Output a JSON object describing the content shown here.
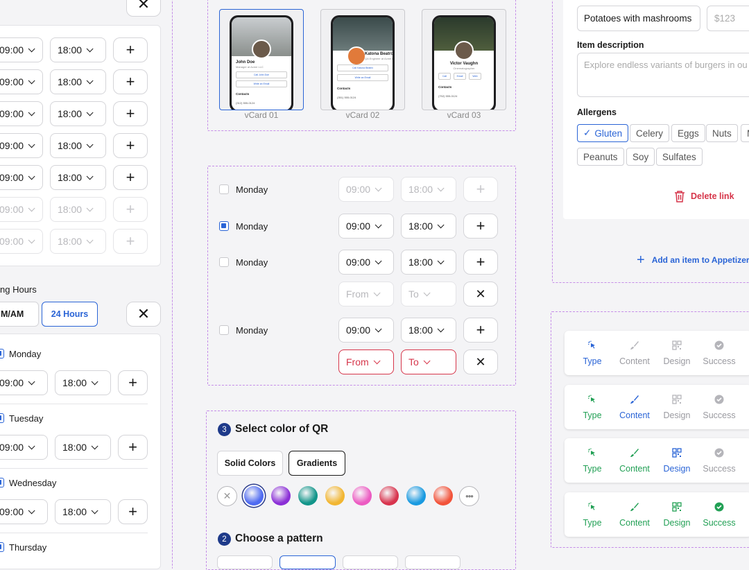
{
  "left": {
    "hours": [
      {
        "from": "09:00",
        "to": "18:00",
        "disabled": false
      },
      {
        "from": "09:00",
        "to": "18:00",
        "disabled": false
      },
      {
        "from": "09:00",
        "to": "18:00",
        "disabled": false
      },
      {
        "from": "09:00",
        "to": "18:00",
        "disabled": false
      },
      {
        "from": "09:00",
        "to": "18:00",
        "disabled": false
      },
      {
        "from": "09:00",
        "to": "18:00",
        "disabled": true
      },
      {
        "from": "09:00",
        "to": "18:00",
        "disabled": true
      }
    ],
    "section_label": "ng Hours",
    "fmt_am": "M/AM",
    "fmt_24": "24 Hours",
    "days": [
      {
        "day": "Monday",
        "from": "09:00",
        "to": "18:00"
      },
      {
        "day": "Tuesday",
        "from": "09:00",
        "to": "18:00"
      },
      {
        "day": "Wednesday",
        "from": "09:00",
        "to": "18:00"
      },
      {
        "day": "Thursday"
      }
    ]
  },
  "vcards": [
    {
      "label": "vCard 01",
      "name": "John Doe",
      "role": "Manager at Acme LLC",
      "btn1": "Call John Doe",
      "btn2": "Write an Email",
      "contacts": "Contacts",
      "phone": "(312) 555-0124"
    },
    {
      "label": "vCard 02",
      "name": "Katona Beatrix",
      "role": "QA Engineer at Acme LLC",
      "btn1": "Call Katona Beatrix",
      "btn2": "Write an Email",
      "contacts": "Contacts",
      "phone": "(351) 555-0124"
    },
    {
      "label": "vCard 03",
      "name": "Victor Vaughn",
      "role": "Cinematographer",
      "btn1": "Call",
      "btn2": "Email",
      "btn3": "Web",
      "contacts": "Contacts",
      "phone": "(752) 555-0124"
    }
  ],
  "schedule": {
    "rows": [
      {
        "day": "Monday",
        "from": "09:00",
        "to": "18:00"
      },
      {
        "day": "Monday",
        "from": "09:00",
        "to": "18:00"
      },
      {
        "day": "Monday",
        "from": "09:00",
        "to": "18:00",
        "extra_from": "From",
        "extra_to": "To"
      },
      {
        "day": "Monday",
        "from": "09:00",
        "to": "18:00",
        "extra_from": "From",
        "extra_to": "To"
      }
    ]
  },
  "qr": {
    "step3_num": "3",
    "step3_title": "Select color of QR",
    "tab_solid": "Solid Colors",
    "tab_grad": "Gradients",
    "colors": [
      "#4f6bf2",
      "#8b2fd6",
      "#12958a",
      "#f2b632",
      "#ec5bc2",
      "#d8344e",
      "#1a9ae0",
      "#f2533a"
    ],
    "step2_num": "2",
    "step2_title": "Choose a pattern"
  },
  "item": {
    "name": "Potatoes with mashrooms",
    "price_placeholder": "$123",
    "desc_label": "Item description",
    "desc_placeholder": "Explore endless variants of burgers in ou",
    "allergens_label": "Allergens",
    "allergens": [
      "Gluten",
      "Celery",
      "Eggs",
      "Nuts",
      "M",
      "Peanuts",
      "Soy",
      "Sulfates"
    ],
    "delete": "Delete link",
    "add": "Add an item to Appetizers"
  },
  "steps": {
    "labels": [
      "Type",
      "Content",
      "Design",
      "Success"
    ]
  },
  "colors": {
    "accent": "#2a64d6",
    "success": "#22a055",
    "error": "#d6354a",
    "dashed": "#c58de8"
  }
}
